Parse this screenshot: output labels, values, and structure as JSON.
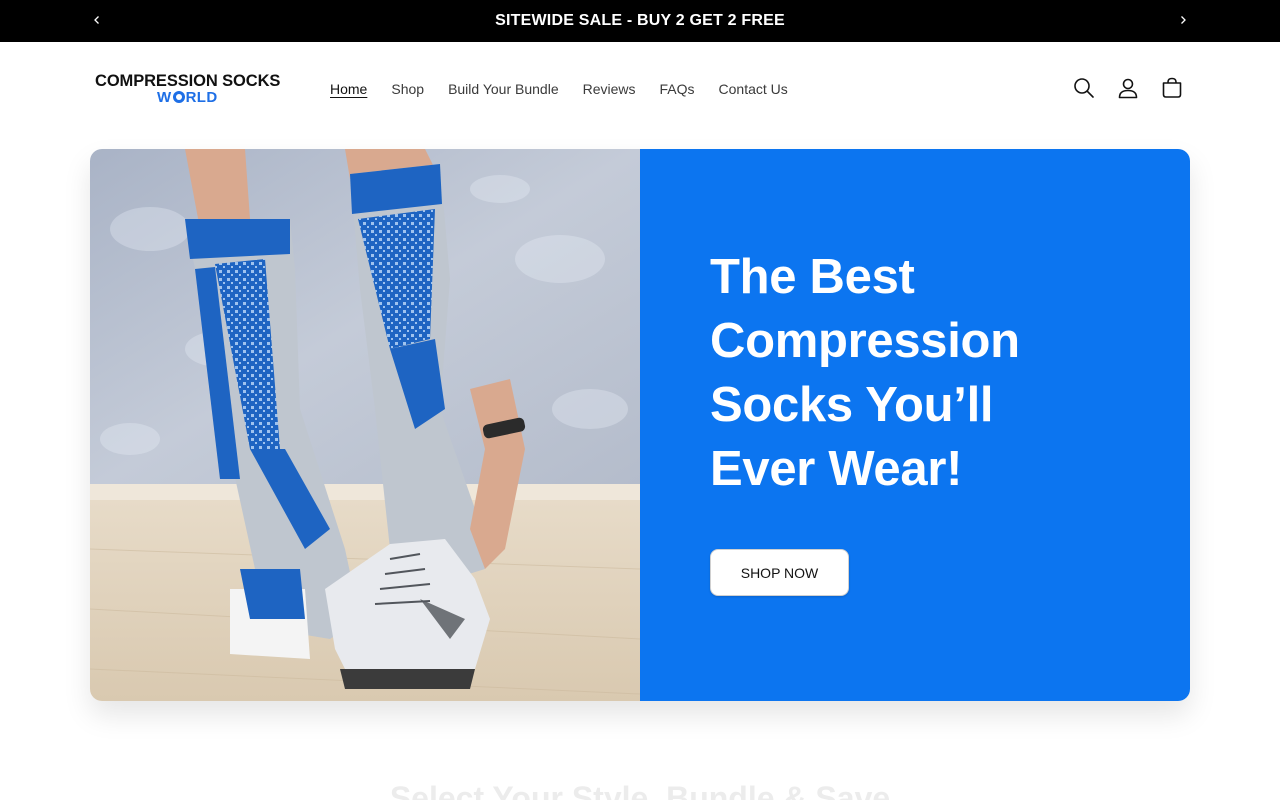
{
  "announcement": {
    "text": "SITEWIDE SALE - BUY 2 GET 2 FREE",
    "prev_icon": "chevron-left-icon",
    "next_icon": "chevron-right-icon"
  },
  "header": {
    "logo": {
      "line1": "COMPRESSION SOCKS",
      "line2_pre": "W",
      "line2_post": "RLD"
    },
    "nav": [
      {
        "label": "Home",
        "active": true
      },
      {
        "label": "Shop",
        "active": false
      },
      {
        "label": "Build Your Bundle",
        "active": false
      },
      {
        "label": "Reviews",
        "active": false
      },
      {
        "label": "FAQs",
        "active": false
      },
      {
        "label": "Contact Us",
        "active": false
      }
    ],
    "icons": [
      "search-icon",
      "account-icon",
      "cart-icon"
    ]
  },
  "hero": {
    "heading": "The Best Compression Socks You’ll Ever Wear!",
    "button_label": "SHOP NOW",
    "panel_color": "#0c75f0"
  },
  "next_section": {
    "title": "Select Your Style, Bundle & Save"
  },
  "colors": {
    "brand_blue": "#1e6fe6",
    "announcement_bg": "#000000"
  }
}
